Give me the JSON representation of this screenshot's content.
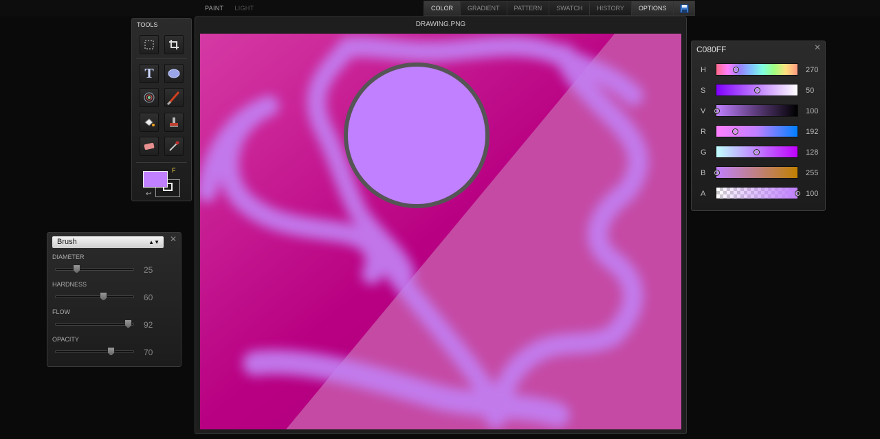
{
  "topbar": {
    "paint": "PAINT",
    "light": "LIGHT",
    "tabs": [
      "COLOR",
      "GRADIENT",
      "PATTERN",
      "SWATCH",
      "HISTORY",
      "OPTIONS"
    ],
    "active_tab": "OPTIONS",
    "save_icon": "floppy-disk-icon"
  },
  "tools": {
    "title": "TOOLS",
    "items": [
      "marquee-select-icon",
      "crop-icon",
      "text-tool-icon",
      "ellipse-shape-icon",
      "spirograph-icon",
      "brush-icon",
      "paint-bucket-icon",
      "stamp-icon",
      "eraser-icon",
      "eyedropper-icon"
    ],
    "fg_color": "#C080FF",
    "fg_label": "F"
  },
  "canvas": {
    "title": "DRAWING.PNG"
  },
  "brush": {
    "type": "Brush",
    "sliders": [
      {
        "label": "DIAMETER",
        "value": "25"
      },
      {
        "label": "HARDNESS",
        "value": "60"
      },
      {
        "label": "FLOW",
        "value": "92"
      },
      {
        "label": "OPACITY",
        "value": "70"
      }
    ]
  },
  "color": {
    "hex": "C080FF",
    "channels": [
      {
        "label": "H",
        "value": "270"
      },
      {
        "label": "S",
        "value": "50"
      },
      {
        "label": "V",
        "value": "100"
      },
      {
        "label": "R",
        "value": "192"
      },
      {
        "label": "G",
        "value": "128"
      },
      {
        "label": "B",
        "value": "255"
      },
      {
        "label": "A",
        "value": "100"
      }
    ]
  }
}
